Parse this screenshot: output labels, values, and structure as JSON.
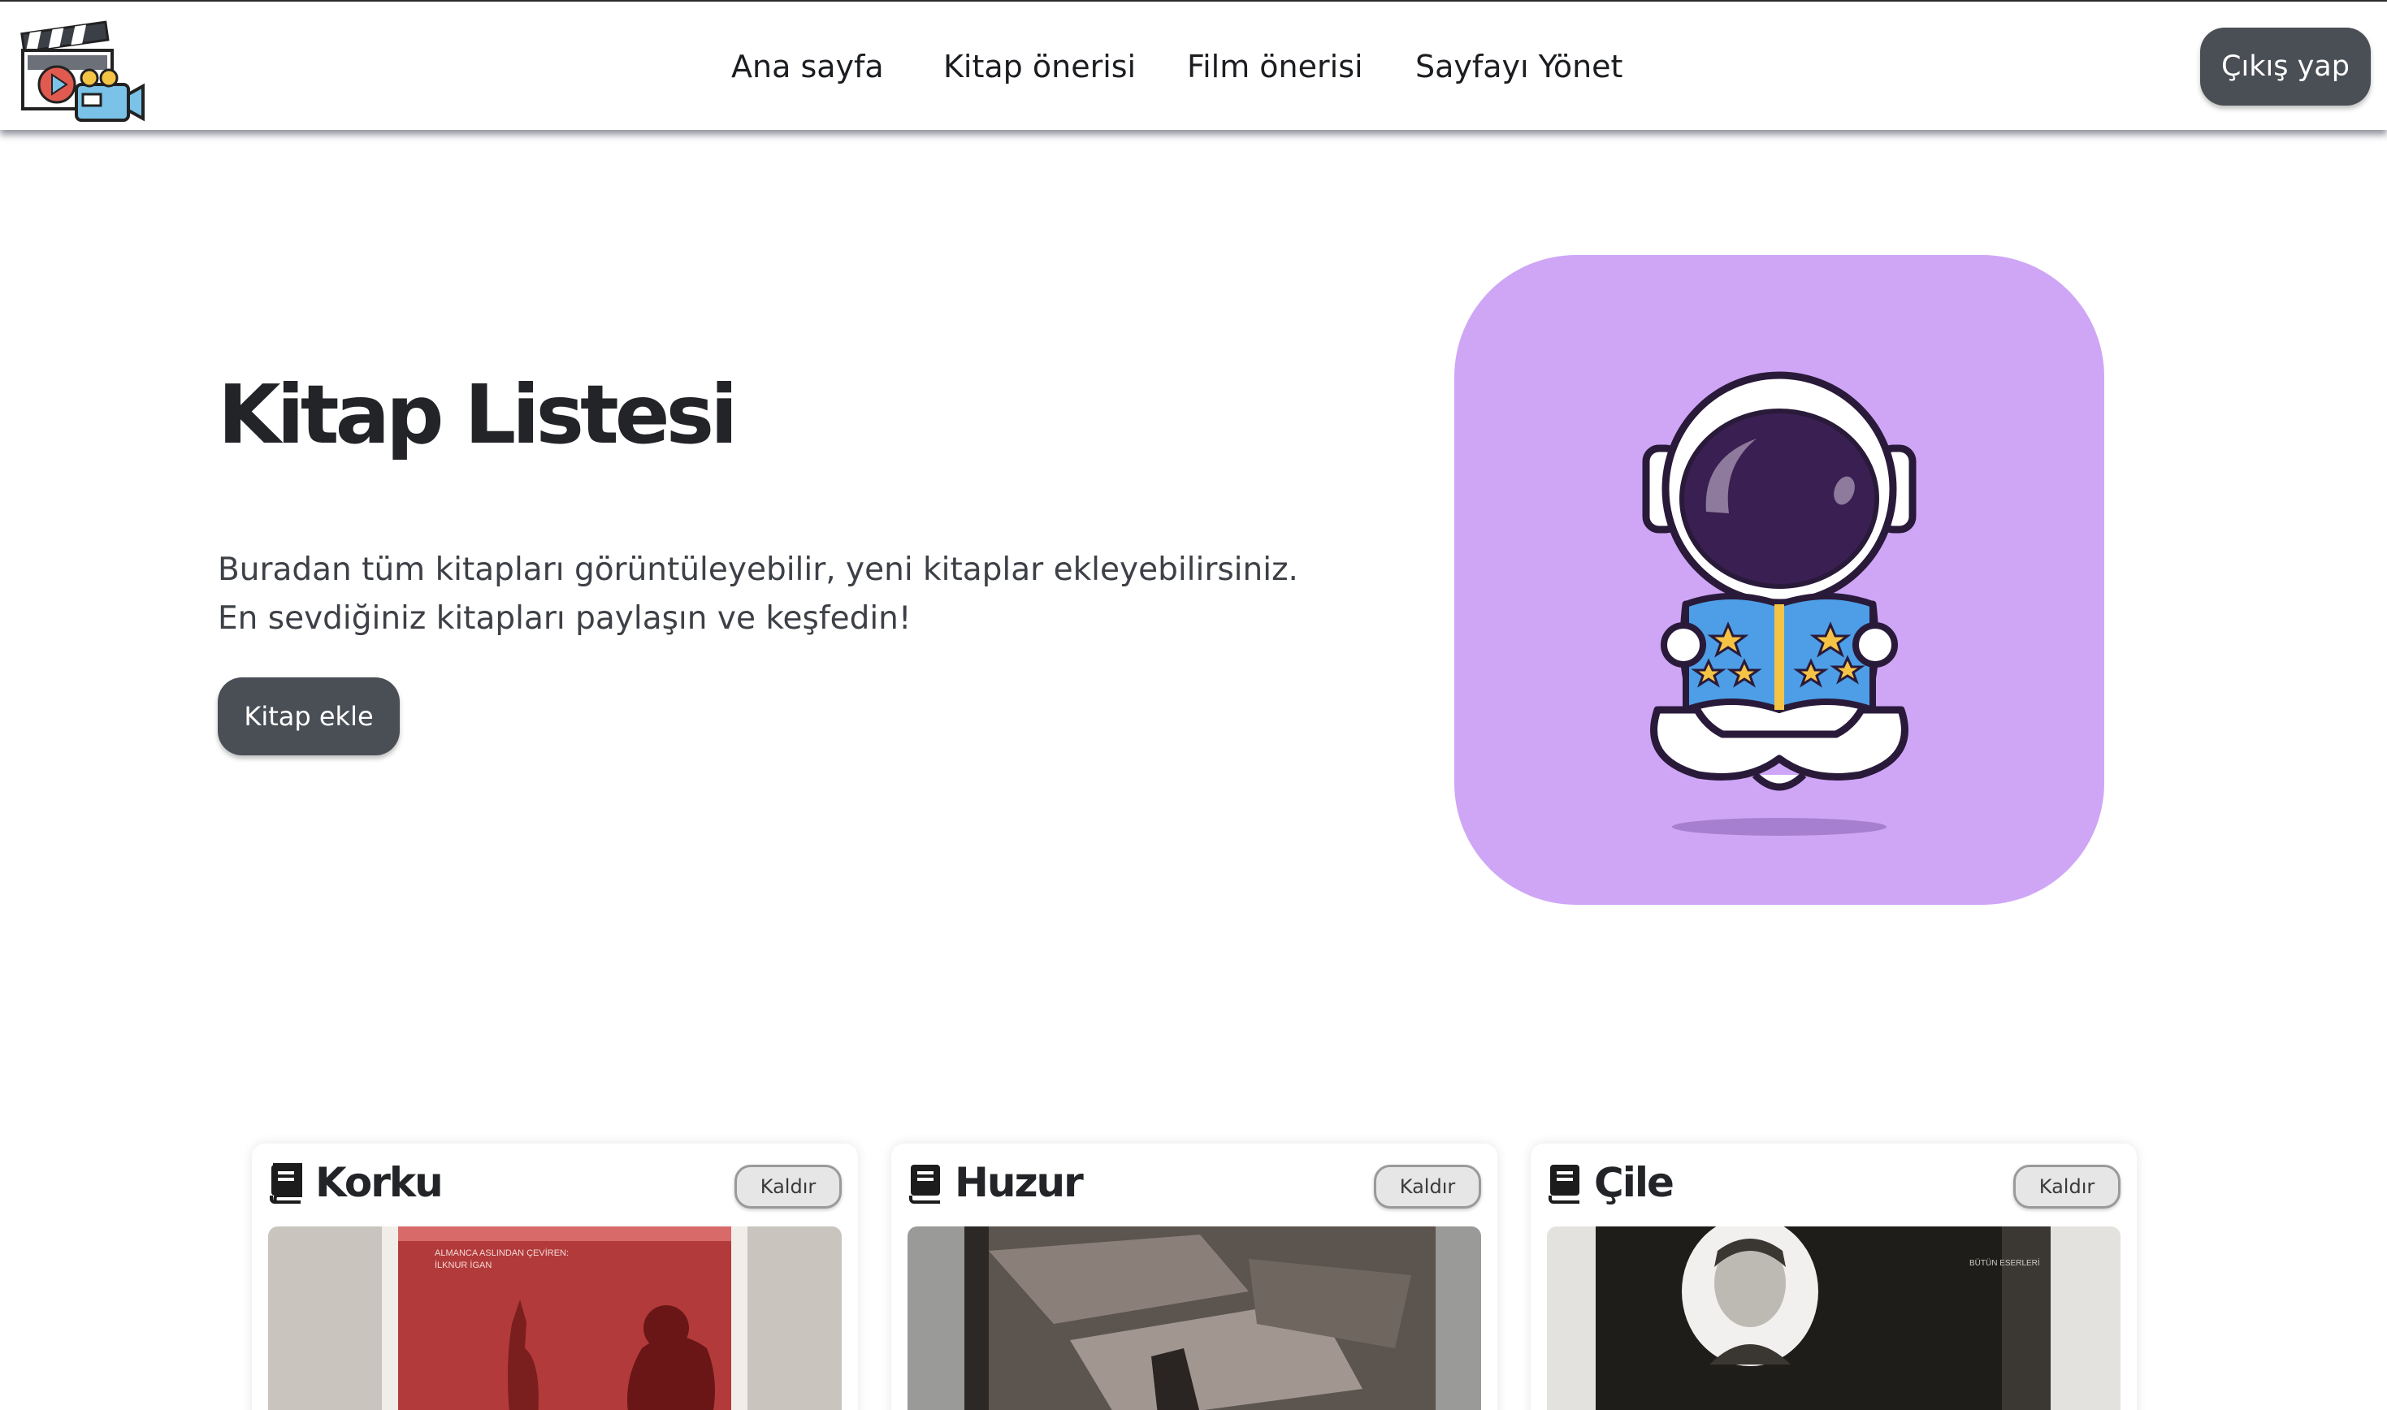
{
  "nav": {
    "logo_icon": "film-clapper-camera-icon",
    "links": [
      "Ana sayfa",
      "Kitap önerisi",
      "Film önerisi",
      "Sayfayı Yönet"
    ],
    "logout_label": "Çıkış yap"
  },
  "hero": {
    "title": "Kitap Listesi",
    "description_line1": "Buradan tüm kitapları görüntüleyebilir, yeni kitaplar ekleyebilirsiniz.",
    "description_line2": "En sevdiğiniz kitapları paylaşın ve keşfedin!",
    "add_button_label": "Kitap ekle",
    "illustration": "astronaut-reading-book-icon",
    "illustration_bg": "#cfa6f6"
  },
  "books": [
    {
      "title": "Korku",
      "remove_label": "Kaldır",
      "icon": "book-icon"
    },
    {
      "title": "Huzur",
      "remove_label": "Kaldır",
      "icon": "book-icon"
    },
    {
      "title": "Çile",
      "remove_label": "Kaldır",
      "icon": "book-icon"
    }
  ],
  "colors": {
    "button_bg": "#4a4e55",
    "text_dark": "#222428"
  }
}
